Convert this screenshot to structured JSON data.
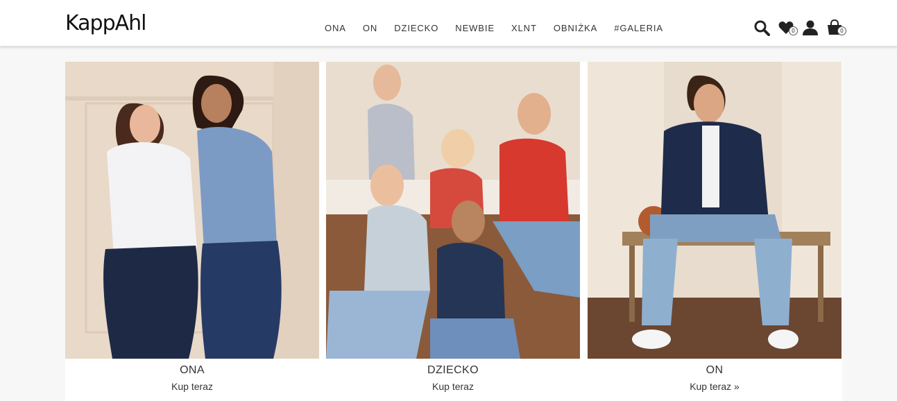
{
  "header": {
    "logo": "KappAhl",
    "nav": [
      "ONA",
      "ON",
      "DZIECKO",
      "NEWBIE",
      "XLNT",
      "OBNIŻKA",
      "#GALERIA"
    ],
    "icons": {
      "search": "search-icon",
      "wishlist": "heart-icon",
      "account": "user-icon",
      "cart": "shopping-bag-icon"
    },
    "wishlist_count": "0",
    "cart_count": "0"
  },
  "cards": [
    {
      "title": "ONA",
      "cta": "Kup teraz",
      "image": "women-in-denim-photo"
    },
    {
      "title": "DZIECKO",
      "cta": "Kup teraz",
      "image": "kids-group-photo"
    },
    {
      "title": "ON",
      "cta": "Kup teraz »",
      "image": "man-on-bench-photo"
    }
  ],
  "colors": {
    "page_bg": "#f7f7f7",
    "header_bg": "#ffffff",
    "text": "#333333"
  }
}
